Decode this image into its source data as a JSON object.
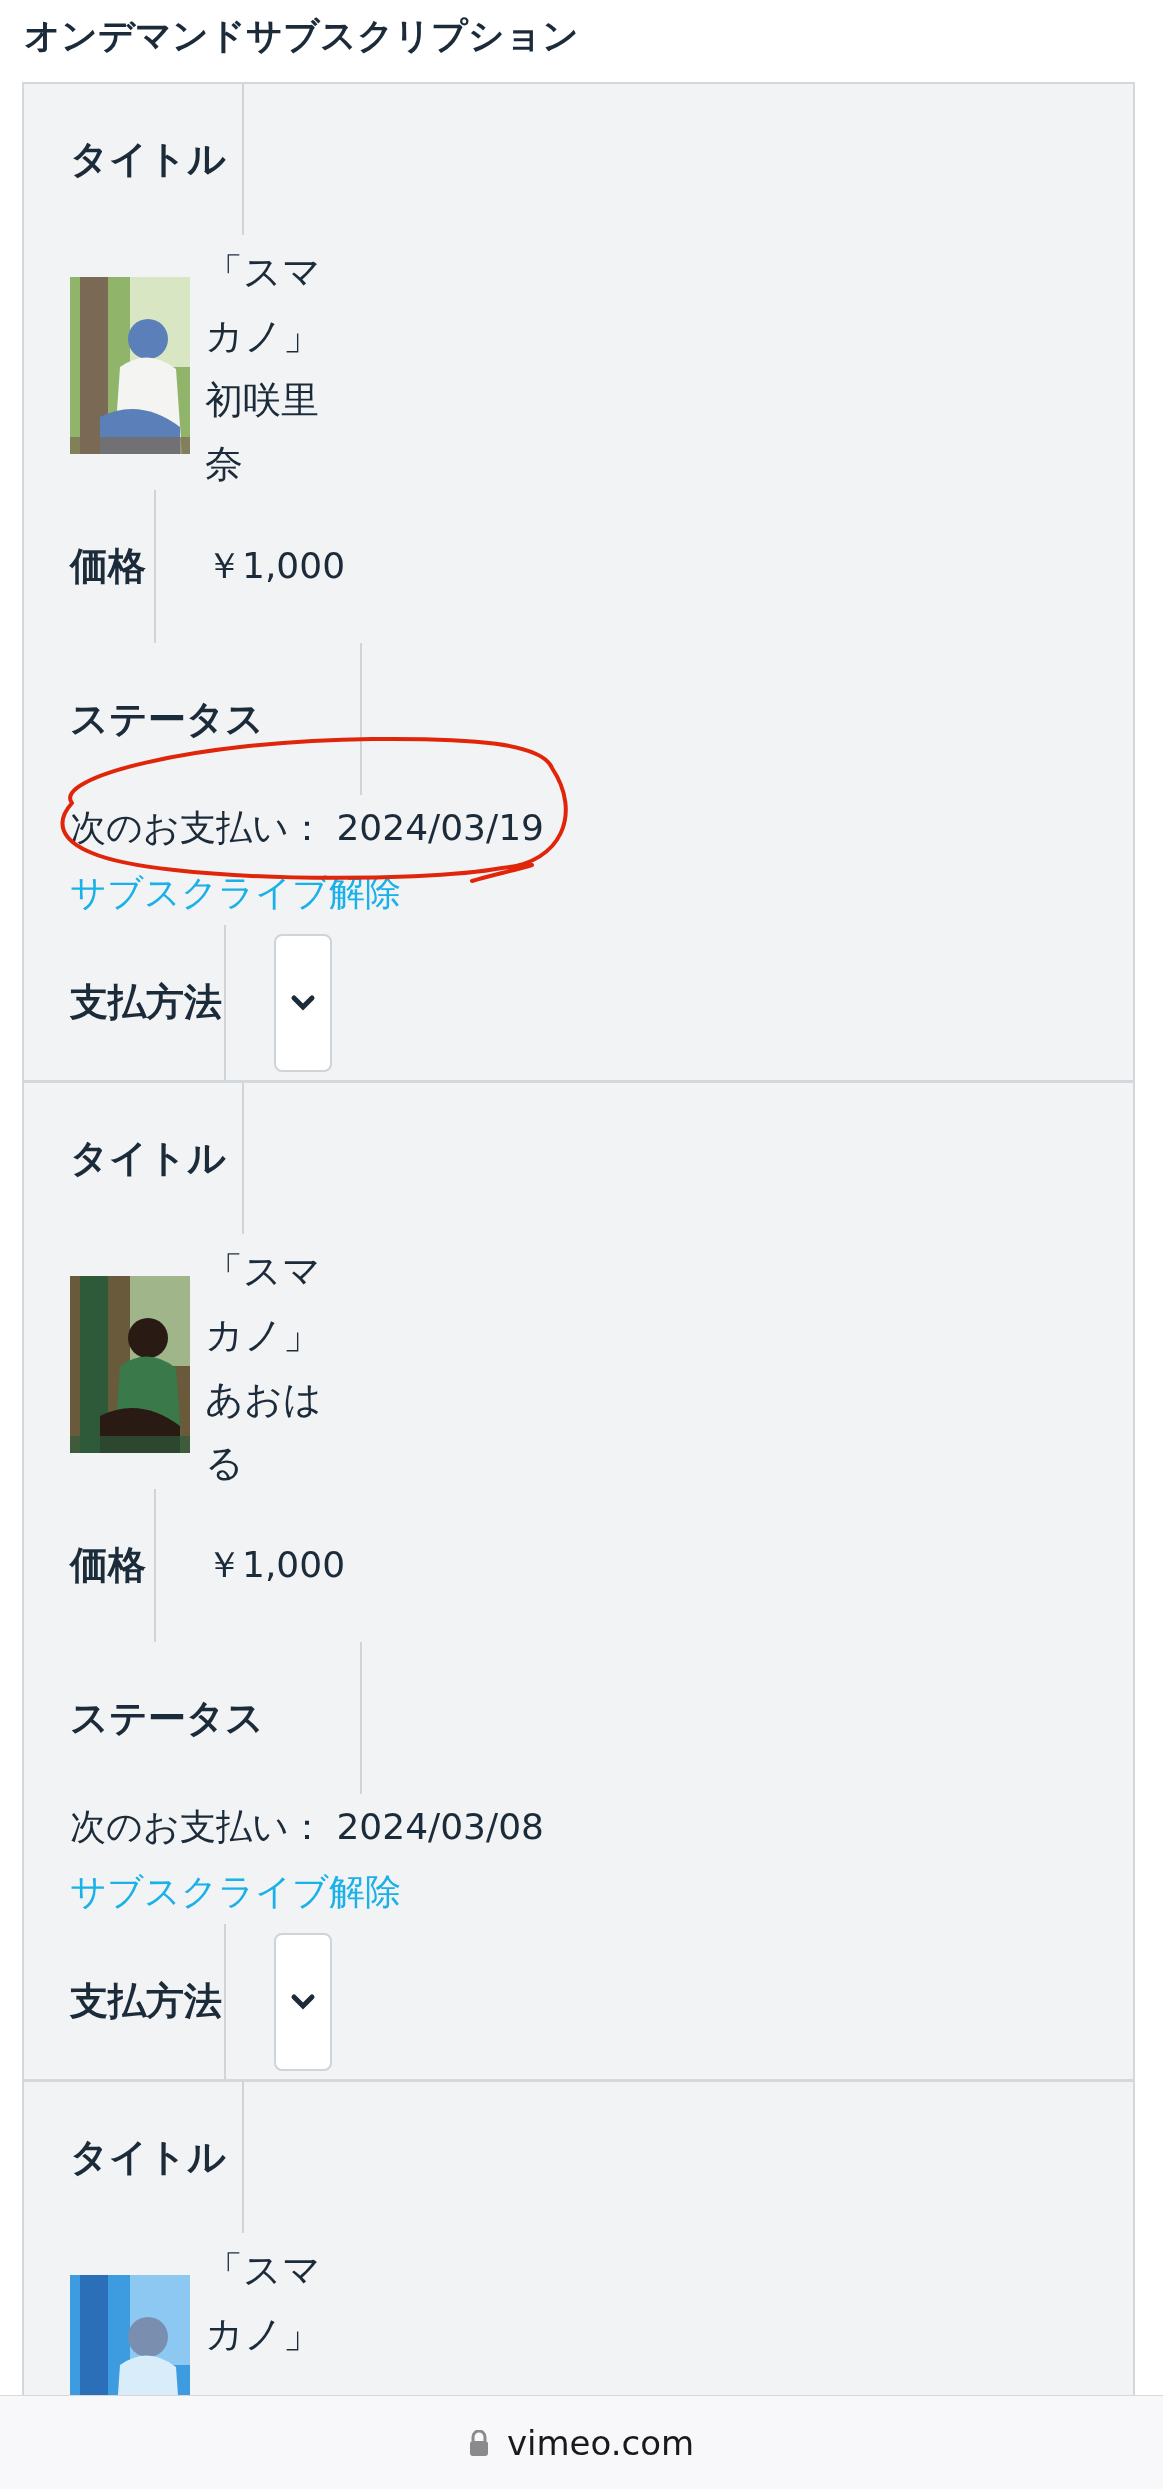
{
  "page_title": "オンデマンドサブスクリプション",
  "subscriptions": [
    {
      "title_label": "タイトル",
      "title": "「スマカノ」初咲里奈",
      "price_label": "価格",
      "price": "￥1,000",
      "status_label": "ステータス",
      "next_payment": "次のお支払い： 2024/03/19",
      "highlighted": true,
      "cancel_link": "サブスクライブ解除",
      "payment_label": "支払方法"
    },
    {
      "title_label": "タイトル",
      "title": "「スマカノ」あおはる",
      "price_label": "価格",
      "price": "￥1,000",
      "status_label": "ステータス",
      "next_payment": "次のお支払い： 2024/03/08",
      "highlighted": false,
      "cancel_link": "サブスクライブ解除",
      "payment_label": "支払方法"
    },
    {
      "title_label": "タイトル",
      "title": "「スマカノ」"
    }
  ],
  "browser_bar": {
    "url": "vimeo.com"
  }
}
